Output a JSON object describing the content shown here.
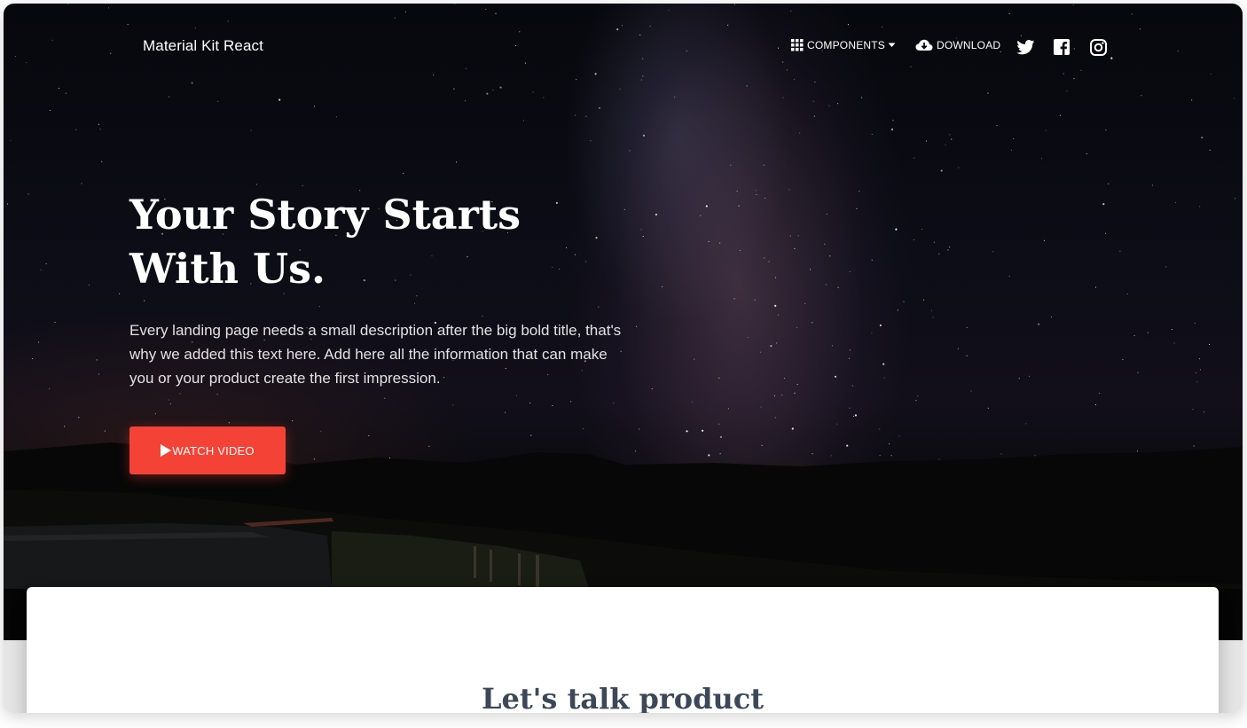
{
  "navbar": {
    "brand": "Material Kit React",
    "components_label": "COMPONENTS",
    "download_label": "DOWNLOAD",
    "icons": {
      "components": "grid-apps-icon",
      "caret": "caret-down-icon",
      "download": "cloud-download-icon",
      "twitter": "twitter-icon",
      "facebook": "facebook-icon",
      "instagram": "instagram-icon"
    }
  },
  "hero": {
    "title_line1": "Your Story Starts",
    "title_line2": "With Us.",
    "description": "Every landing page needs a small description after the big bold title, that's why we added this text here. Add here all the information that can make you or your product create the first impression.",
    "button_label": "WATCH VIDEO",
    "button_icon": "play-icon"
  },
  "section": {
    "title": "Let's talk product"
  },
  "colors": {
    "accent": "#f44336",
    "section_title": "#3c4858",
    "hero_text": "#ffffff"
  }
}
